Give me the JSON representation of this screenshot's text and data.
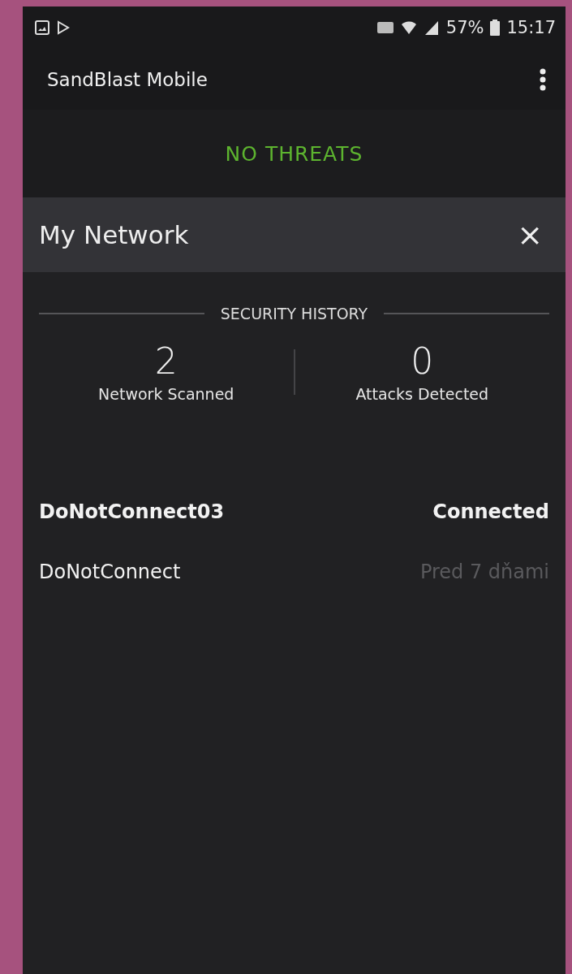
{
  "status_bar": {
    "battery_percent": "57%",
    "time": "15:17"
  },
  "app_bar": {
    "title": "SandBlast Mobile"
  },
  "banner": {
    "text": "NO THREATS"
  },
  "panel": {
    "title": "My Network",
    "close": "×"
  },
  "security_history": {
    "heading": "SECURITY HISTORY",
    "stats": [
      {
        "value": "2",
        "label": "Network Scanned"
      },
      {
        "value": "0",
        "label": "Attacks Detected"
      }
    ]
  },
  "networks": [
    {
      "name": "DoNotConnect03",
      "status": "Connected",
      "connected": true
    },
    {
      "name": "DoNotConnect",
      "status": "Pred 7 dňami",
      "connected": false
    }
  ]
}
